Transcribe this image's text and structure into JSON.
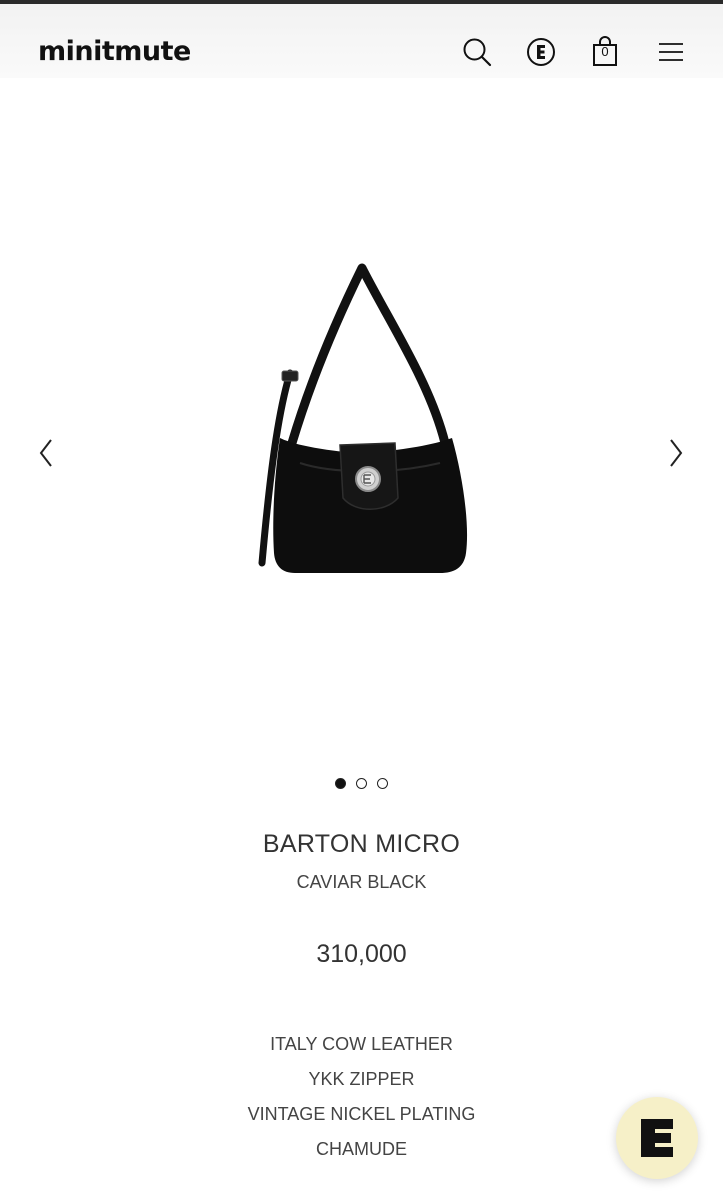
{
  "header": {
    "logo": "minitmute",
    "icons": [
      "search-icon",
      "brand-e-icon",
      "shopping-bag-icon",
      "menu-icon"
    ],
    "cart_count": "0"
  },
  "carousel": {
    "slide_count": 3,
    "active_index": 0,
    "prev_icon": "chevron-left-icon",
    "next_icon": "chevron-right-icon"
  },
  "product": {
    "name": "BARTON MICRO",
    "color": "CAVIAR BLACK",
    "price": "310,000",
    "features": [
      "ITALY COW LEATHER",
      "YKK ZIPPER",
      "VINTAGE NICKEL PLATING",
      "CHAMUDE"
    ]
  },
  "chat": {
    "icon": "chat-bubble-icon",
    "background": "#f6f0c8"
  }
}
